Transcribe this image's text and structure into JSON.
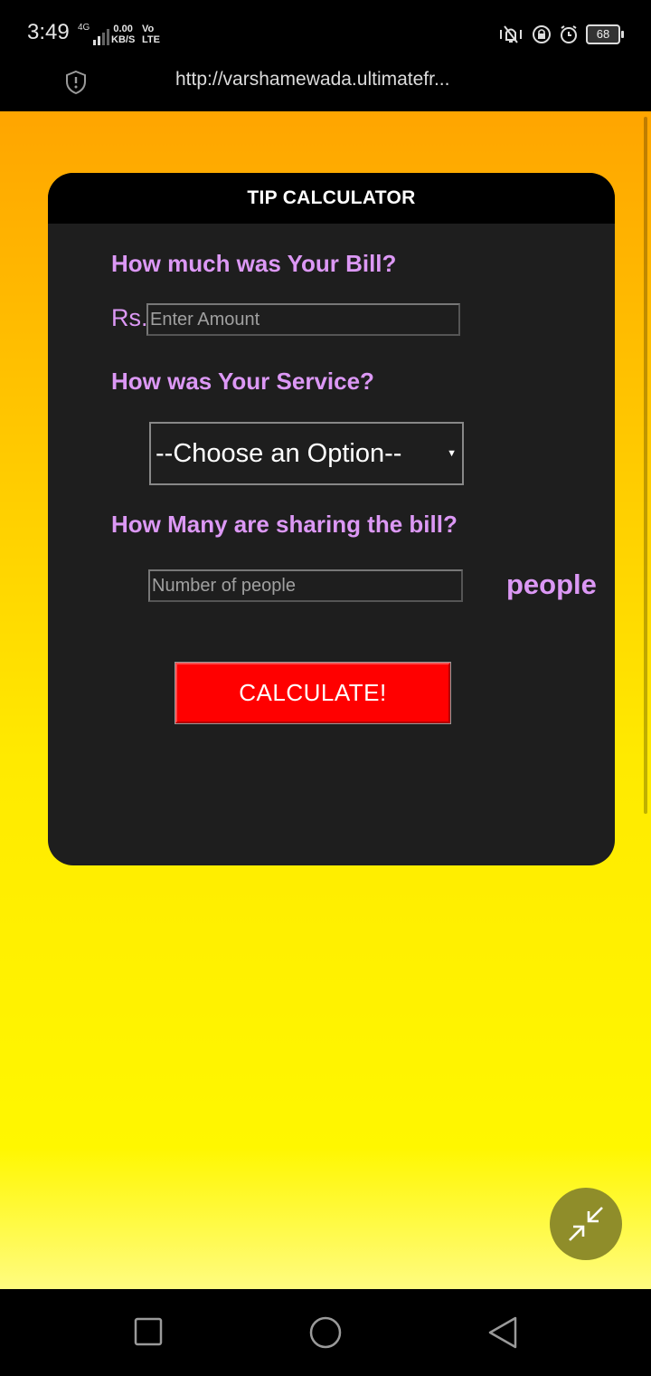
{
  "status_bar": {
    "time": "3:49",
    "network_type": "4G",
    "net_speed_value": "0.00",
    "net_speed_unit": "KB/S",
    "volte_top": "Vo",
    "volte_bottom": "LTE",
    "battery_level": "68"
  },
  "browser": {
    "url": "http://varshamewada.ultimatefr..."
  },
  "calculator": {
    "title": "TIP CALCULATOR",
    "bill_question": "How much was Your Bill?",
    "currency_label": "Rs.",
    "amount_placeholder": "Enter Amount",
    "service_question": "How was Your Service?",
    "service_selected": "--Choose an Option--",
    "sharing_question": "How Many are sharing the bill?",
    "people_placeholder": "Number of people",
    "people_unit": "people",
    "calculate_label": "CALCULATE!"
  },
  "colors": {
    "accent_label": "#dc98f5",
    "button": "#ff0000",
    "card": "#1e1e1e",
    "gradient_top": "#ffa500",
    "gradient_bottom": "#fff700"
  },
  "icons": {
    "fab": "minimize-arrows-icon",
    "nav": [
      "recent-apps-icon",
      "home-icon",
      "back-icon"
    ]
  }
}
